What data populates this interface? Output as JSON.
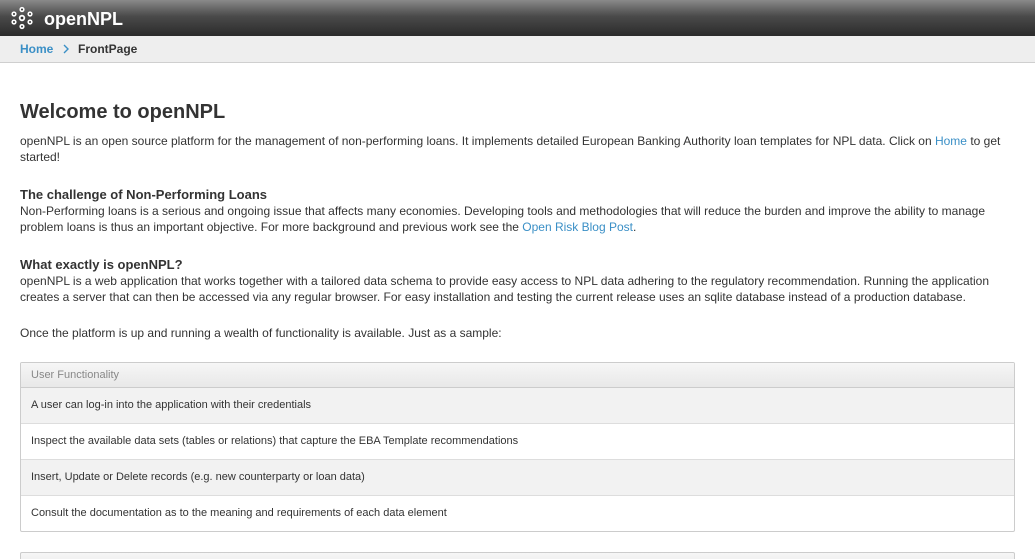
{
  "header": {
    "brand": "openNPL",
    "logo_icon": "network-nodes-icon"
  },
  "breadcrumb": {
    "home": "Home",
    "current": "FrontPage"
  },
  "main": {
    "title": "Welcome to openNPL",
    "intro_before_link": "openNPL is an open source platform for the management of non-performing loans. It implements detailed European Banking Authority loan templates for NPL data. Click on ",
    "intro_link": "Home",
    "intro_after_link": " to get started!",
    "challenge_heading": "The challenge of Non-Performing Loans",
    "challenge_before_link": "Non-Performing loans is a serious and ongoing issue that affects many economies. Developing tools and methodologies that will reduce the burden and improve the ability to manage problem loans is thus an important objective. For more background and previous work see the ",
    "challenge_link": "Open Risk Blog Post",
    "challenge_after_link": ".",
    "what_heading": "What exactly is openNPL?",
    "what_text": "openNPL is a web application that works together with a tailored data schema to provide easy access to NPL data adhering to the regulatory recommendation. Running the application creates a server that can then be accessed via any regular browser. For easy installation and testing the current release uses an sqlite database instead of a production database.",
    "sample_text": "Once the platform is up and running a wealth of functionality is available. Just as a sample:"
  },
  "user_functionality": {
    "heading": "User Functionality",
    "items": [
      "A user can log-in into the application with their credentials",
      "Inspect the available data sets (tables or relations) that capture the EBA Template recommendations",
      "Insert, Update or Delete records (e.g. new counterparty or loan data)",
      "Consult the documentation as to the meaning and requirements of each data element"
    ]
  },
  "colors": {
    "link": "#3a8fc6",
    "header_dark": "#2b2b2b"
  }
}
